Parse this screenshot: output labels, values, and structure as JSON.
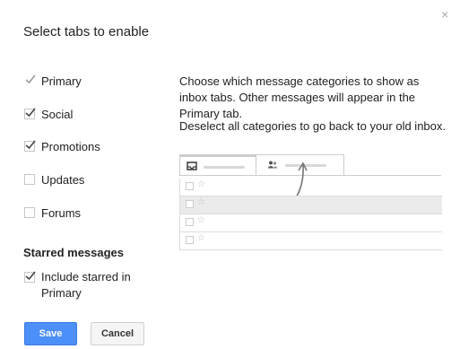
{
  "dialog": {
    "title": "Select tabs to enable",
    "close_glyph": "×"
  },
  "categories": [
    {
      "label": "Primary",
      "checked": true,
      "locked": true
    },
    {
      "label": "Social",
      "checked": true
    },
    {
      "label": "Promotions",
      "checked": true
    },
    {
      "label": "Updates",
      "checked": false
    },
    {
      "label": "Forums",
      "checked": false
    }
  ],
  "starred": {
    "section_title": "Starred messages",
    "option_line1": "Include starred in",
    "option_line2": "Primary",
    "checked": true
  },
  "description": {
    "text1": "Choose which message categories to show as inbox tabs. Other messages will appear in the Primary tab.",
    "text2": "Deselect all categories to go back to your old inbox."
  },
  "illustration": {
    "tab_icons": [
      "inbox-icon",
      "people-icon"
    ],
    "row_checkbox_glyph": "☐",
    "row_star_glyph": "☆"
  },
  "buttons": {
    "save": "Save",
    "cancel": "Cancel"
  },
  "colors": {
    "save_button": "#4d8ff8",
    "check_mark": "#444444",
    "disabled_check": "#9a9a9a"
  }
}
